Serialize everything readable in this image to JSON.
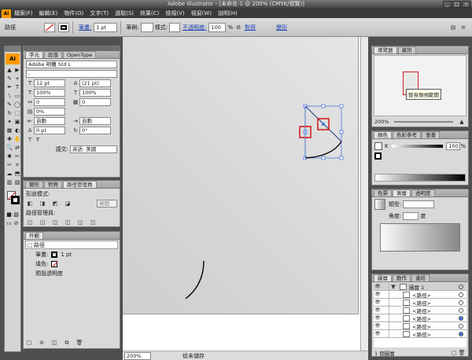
{
  "window": {
    "title": "Adobe Illustrator - [未命名-1 @ 200% (CMYK/預覽)]",
    "buttons": [
      "_",
      "□",
      "×"
    ]
  },
  "menu": {
    "logo": "Ai",
    "items": [
      "檔案(F)",
      "編輯(E)",
      "物件(O)",
      "文字(T)",
      "選取(S)",
      "效果(C)",
      "檢視(V)",
      "視窗(W)",
      "說明(H)"
    ]
  },
  "control": {
    "label": "路徑",
    "stroke_label": "筆畫:",
    "stroke_value": "1 pt",
    "variable_label": "筆刷:",
    "style_label": "樣式:",
    "opacity_label": "不透明度:",
    "opacity_value": "100",
    "opacity_unit": "%",
    "align_link": "對齊",
    "transform_link": "變形"
  },
  "tools": {
    "logo": "Ai",
    "icons": [
      "▲",
      "▶",
      "✎",
      "⌖",
      "✒",
      "T",
      "\\",
      "▭",
      "✎",
      "◯",
      "↻",
      "⬚",
      "✦",
      "▣",
      "▦",
      "◐",
      "✚",
      "✋",
      "🔍",
      "⇄"
    ]
  },
  "char_panel": {
    "tabs": [
      "字元",
      "段落",
      "OpenType"
    ],
    "font": "Adobe 明體 Std L",
    "style": "-",
    "size": "12 pt",
    "leading": "(21 pt)",
    "hscale": "100%",
    "vscale": "100%",
    "kerning": "0",
    "tracking": "0",
    "tsume": "0%",
    "aki1": "自動",
    "aki2": "自動",
    "aki3": "自動",
    "aki4": "自動",
    "baseline": "0 pt",
    "rotation": "0°",
    "lang_label": "語文:",
    "lang": "英語: 美國"
  },
  "pathfinder_panel": {
    "tabs": [
      "變形",
      "對齊",
      "路徑管理員"
    ],
    "shape_modes": "形狀模式:",
    "expand": "展開",
    "pathfinders": "路徑管理員:"
  },
  "appearance_panel": {
    "tabs": [
      "外觀"
    ],
    "title": "路徑",
    "stroke_label": "筆畫:",
    "stroke_value": "1 pt",
    "fill_label": "填色:",
    "opacity_label": "預設透明度"
  },
  "navigator_panel": {
    "tabs": [
      "導覽器",
      "資訊"
    ],
    "tooltip": "替身預視範圍",
    "zoom": "200%"
  },
  "color_panel": {
    "tabs": [
      "顏色",
      "色彩參考",
      "筆畫"
    ],
    "channel": "K",
    "value": "100",
    "unit": "%"
  },
  "gradient_panel": {
    "tabs": [
      "色票",
      "漸層",
      "透明度"
    ],
    "type_label": "類型:",
    "angle_label": "角度:",
    "degree": "度"
  },
  "layers_panel": {
    "tabs": [
      "圖層",
      "動作",
      "連結"
    ],
    "rows": [
      "圖層 1",
      "<路徑>",
      "<路徑>",
      "<路徑>",
      "<路徑>",
      "<路徑>",
      "<路徑>"
    ],
    "footer": "1 個圖層"
  },
  "status": {
    "zoom": "200%",
    "text": "從未儲存"
  },
  "colors": {
    "accent": "#ff9a00",
    "selection": "#4a79d9",
    "highlight": "#d62020"
  }
}
